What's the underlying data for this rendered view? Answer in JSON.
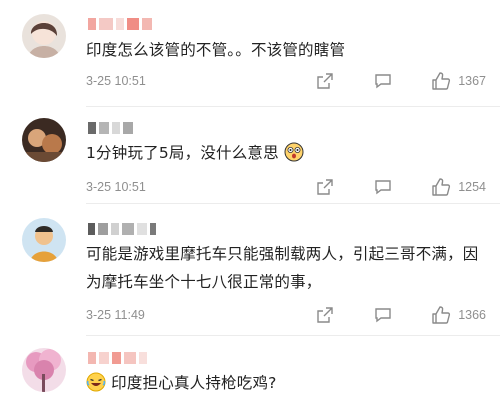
{
  "comments": [
    {
      "text": "印度怎么该管的不管。。不该管的瞎管",
      "time": "3-25 10:51",
      "likes": "1367",
      "icons": [
        "share-icon",
        "comment-icon",
        "like-icon"
      ]
    },
    {
      "text": "1分钟玩了5局，没什么意思",
      "time": "3-25 10:51",
      "likes": "1254",
      "icons": [
        "share-icon",
        "comment-icon",
        "like-icon"
      ]
    },
    {
      "text": "可能是游戏里摩托车只能强制载两人，引起三哥不满，因为摩托车坐个十七八很正常的事，",
      "time": "3-25 11:49",
      "likes": "1366",
      "icons": [
        "share-icon",
        "comment-icon",
        "like-icon"
      ]
    },
    {
      "text": "印度担心真人持枪吃鸡?",
      "icons": [
        "laughing-emoji-icon"
      ]
    }
  ]
}
